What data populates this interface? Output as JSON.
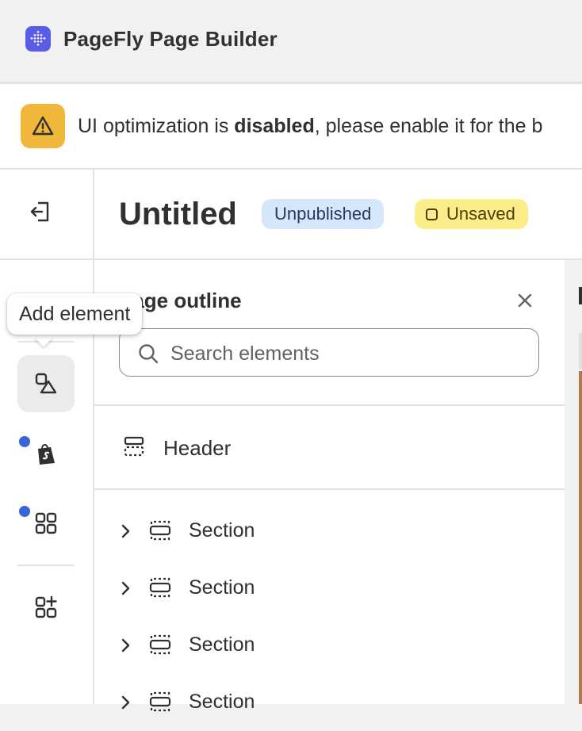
{
  "app": {
    "title": "PageFly Page Builder"
  },
  "banner": {
    "text_before": "UI optimization is ",
    "text_bold": "disabled",
    "text_after": ", please enable it for the b"
  },
  "rail": {
    "tooltip": "Add element",
    "items": [
      {
        "icon": "exit-icon",
        "dot": false
      },
      {
        "icon": "layers-icon",
        "dot": false
      },
      {
        "icon": "shapes-icon",
        "dot": false,
        "active": true
      },
      {
        "icon": "shopify-bag-icon",
        "dot": true
      },
      {
        "icon": "grid-apps-icon",
        "dot": true
      },
      {
        "icon": "add-app-icon",
        "dot": false
      }
    ]
  },
  "page": {
    "title": "Untitled",
    "badges": {
      "published": "Unpublished",
      "saved": "Unsaved"
    }
  },
  "outline": {
    "title": "Page outline",
    "search_placeholder": "Search elements",
    "header_label": "Header",
    "sections": [
      "Section",
      "Section",
      "Section",
      "Section"
    ]
  },
  "colors": {
    "brand": "#5b5ce6",
    "warning": "#f1b73b",
    "badge_unpublished": "#d6e7fb",
    "badge_unsaved": "#fbee8a",
    "notification_dot": "#3866d6"
  }
}
